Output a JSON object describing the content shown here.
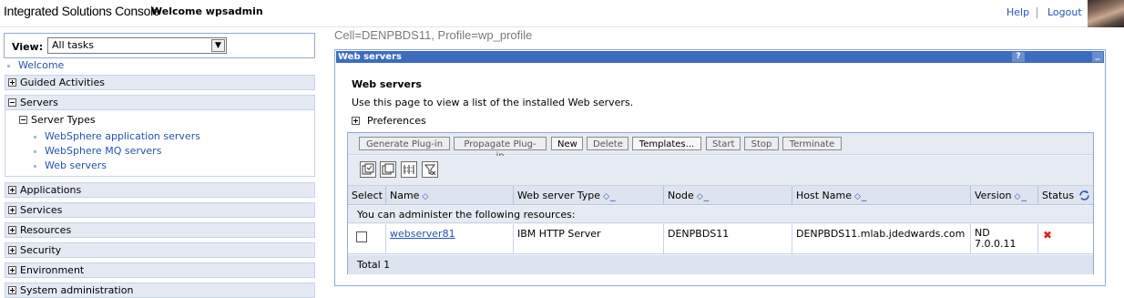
{
  "banner": {
    "app_title": "Integrated Solutions Console",
    "welcome": "Welcome wpsadmin",
    "help": "Help",
    "logout": "Logout"
  },
  "nav": {
    "view_label": "View:",
    "view_value": "All tasks",
    "welcome": "Welcome",
    "categories": {
      "guided": "Guided Activities",
      "servers": "Servers",
      "applications": "Applications",
      "services": "Services",
      "resources": "Resources",
      "security": "Security",
      "environment": "Environment",
      "sysadmin": "System administration"
    },
    "server_types": "Server Types",
    "sub_links": [
      "WebSphere application servers",
      "WebSphere MQ servers",
      "Web servers"
    ]
  },
  "main": {
    "breadcrumb": "Cell=DENPBDS11, Profile=wp_profile",
    "portlet_title": "Web servers",
    "portlet_help": "?",
    "portlet_min": "_",
    "page_title": "Web servers",
    "description": "Use this page to view a list of the installed Web servers.",
    "preferences": "Preferences"
  },
  "table": {
    "buttons": [
      "Generate Plug-in",
      "Propagate Plug-in",
      "New",
      "Delete",
      "Templates...",
      "Start",
      "Stop",
      "Terminate"
    ],
    "columns": [
      "Select",
      "Name",
      "Web server Type",
      "Node",
      "Host Name",
      "Version",
      "Status"
    ],
    "info": "You can administer the following resources:",
    "rows": [
      {
        "name": "webserver81",
        "type": "IBM HTTP Server",
        "node": "DENPBDS11",
        "host": "DENPBDS11.mlab.jdedwards.com",
        "version_line1": "ND",
        "version_line2": "7.0.0.11",
        "status": "stopped"
      }
    ],
    "total": "Total 1"
  },
  "colors": {
    "accent": "#3c6cc0",
    "link": "#2452b0",
    "nav_bg": "#e4e9f3",
    "error": "#dd2222"
  }
}
